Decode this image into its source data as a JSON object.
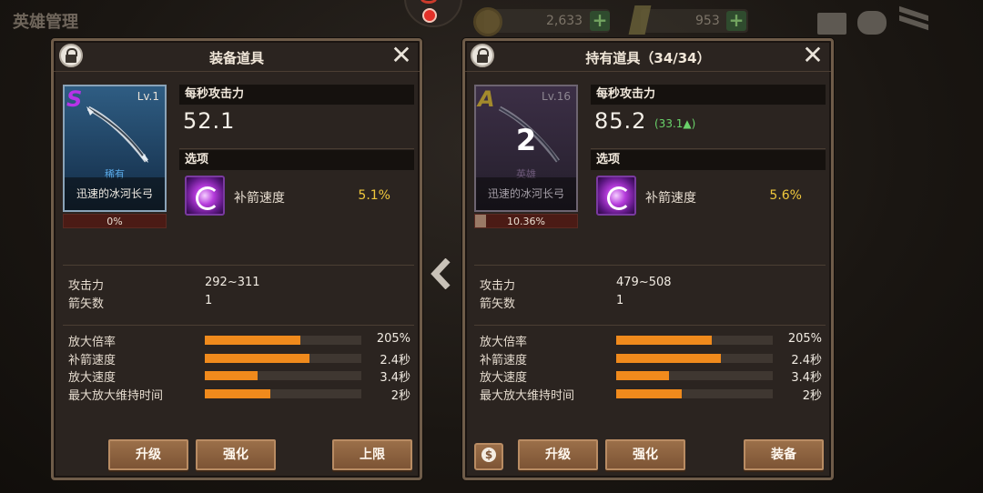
{
  "topbar": {
    "title": "英雄管理",
    "gold": "2,633",
    "gems": "953"
  },
  "left": {
    "title": "装备道具",
    "card": {
      "grade": "S",
      "level": "Lv.1",
      "rarity": "稀有",
      "name": "迅速的冰河长弓"
    },
    "xp": {
      "text": "0%",
      "fraction": 0.0
    },
    "atk_label": "每秒攻击力",
    "atk_value": "52.1",
    "option_label": "选项",
    "option": {
      "name": "补箭速度",
      "value": "5.1%",
      "icon": "purple-clock-icon"
    },
    "base": [
      {
        "label": "攻击力",
        "value": "292~311"
      },
      {
        "label": "箭矢数",
        "value": "1"
      }
    ],
    "bars": [
      {
        "label": "放大倍率",
        "value": "205%",
        "fraction": 0.61
      },
      {
        "label": "补箭速度",
        "value": "2.4秒",
        "fraction": 0.67
      },
      {
        "label": "放大速度",
        "value": "3.4秒",
        "fraction": 0.34
      },
      {
        "label": "最大放大维持时间",
        "value": "2秒",
        "fraction": 0.42
      }
    ],
    "buttons": {
      "upgrade": "升级",
      "enhance": "强化",
      "limit": "上限"
    }
  },
  "right": {
    "title": "持有道具（34/34）",
    "card": {
      "grade": "A",
      "level": "Lv.16",
      "rarity": "英雄",
      "name": "迅速的冰河长弓",
      "count": "2"
    },
    "xp": {
      "text": "10.36%",
      "fraction": 0.1036
    },
    "atk_label": "每秒攻击力",
    "atk_value": "85.2",
    "atk_delta": "(33.1▲)",
    "option_label": "选项",
    "option": {
      "name": "补箭速度",
      "value": "5.6%",
      "icon": "purple-clock-icon"
    },
    "base": [
      {
        "label": "攻击力",
        "value": "479~508"
      },
      {
        "label": "箭矢数",
        "value": "1"
      }
    ],
    "bars": [
      {
        "label": "放大倍率",
        "value": "205%",
        "fraction": 0.61
      },
      {
        "label": "补箭速度",
        "value": "2.4秒",
        "fraction": 0.67
      },
      {
        "label": "放大速度",
        "value": "3.4秒",
        "fraction": 0.34
      },
      {
        "label": "最大放大维持时间",
        "value": "2秒",
        "fraction": 0.42
      }
    ],
    "buttons": {
      "upgrade": "升级",
      "enhance": "强化",
      "equip": "装备"
    }
  },
  "colors": {
    "bar": "#f08a1c",
    "option_value": "#f0c83c",
    "delta": "#6ad26a"
  }
}
